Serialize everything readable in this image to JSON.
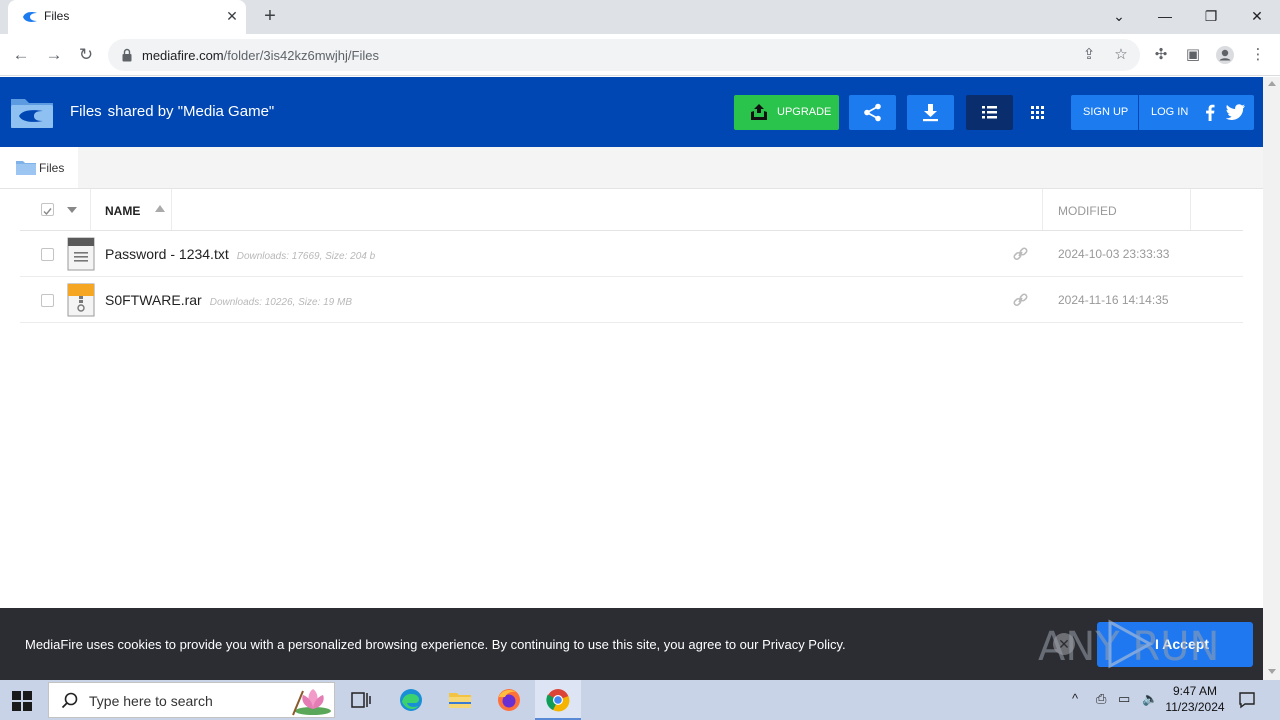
{
  "browser": {
    "tab_title": "Files",
    "url_host": "mediafire.com",
    "url_path": "/folder/3is42kz6mwjhj/Files"
  },
  "header": {
    "folder_name": "Files",
    "shared_by": "shared by \"Media Game\"",
    "upgrade_label": "UPGRADE",
    "signup_label": "SIGN UP",
    "login_label": "LOG IN",
    "brand_color": "#0047b3",
    "upgrade_color": "#2ac34b"
  },
  "breadcrumb": {
    "label": "Files"
  },
  "table": {
    "col_name": "NAME",
    "col_modified": "MODIFIED",
    "rows": [
      {
        "name": "Password - 1234.txt",
        "meta": "Downloads: 17669, Size: 204 b",
        "modified": "2024-10-03 23:33:33",
        "icon": "text-file-icon"
      },
      {
        "name": "S0FTWARE.rar",
        "meta": "Downloads: 10226, Size: 19 MB",
        "modified": "2024-11-16 14:14:35",
        "icon": "archive-file-icon"
      }
    ]
  },
  "cookie": {
    "text": "MediaFire uses cookies to provide you with a personalized browsing experience. By continuing to use this site, you agree to our Privacy Policy.",
    "accept_label": "I Accept",
    "watermark": "ANY RUN"
  },
  "taskbar": {
    "search_placeholder": "Type here to search",
    "time": "9:47 AM",
    "date": "11/23/2024"
  }
}
